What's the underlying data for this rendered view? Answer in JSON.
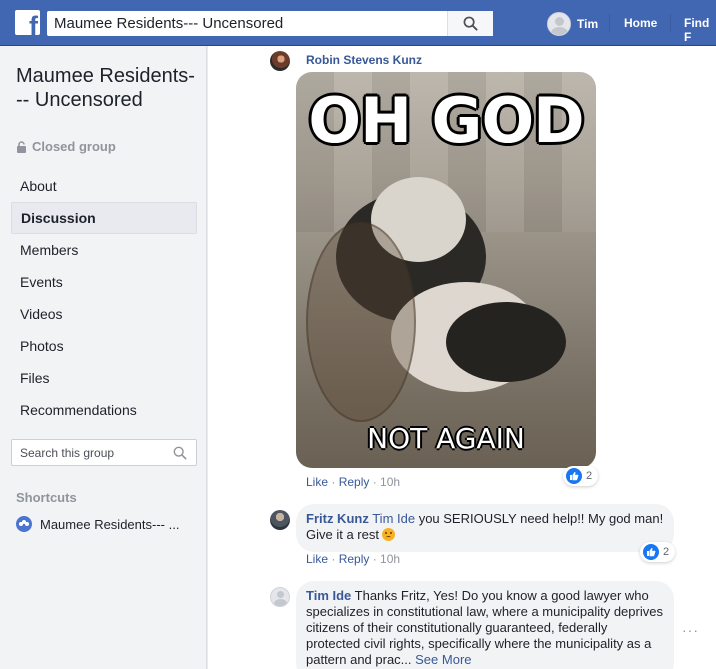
{
  "topbar": {
    "logo_letter": "f",
    "search_value": "Maumee Residents--- Uncensored",
    "user_name": "Tim",
    "nav_home": "Home",
    "nav_find": "Find F"
  },
  "group": {
    "title": "Maumee Residents--- Uncensored",
    "privacy": "Closed group"
  },
  "left_nav": {
    "items": [
      {
        "label": "About"
      },
      {
        "label": "Discussion"
      },
      {
        "label": "Members"
      },
      {
        "label": "Events"
      },
      {
        "label": "Videos"
      },
      {
        "label": "Photos"
      },
      {
        "label": "Files"
      },
      {
        "label": "Recommendations"
      }
    ],
    "active": "Discussion",
    "search_placeholder": "Search this group",
    "shortcuts_title": "Shortcuts",
    "shortcut_item": "Maumee Residents--- ..."
  },
  "comments": [
    {
      "author": "Robin Stevens Kunz",
      "gif_top_text": "OH GOD",
      "gif_bottom_text": "NOT AGAIN",
      "reaction_count": "2",
      "like": "Like",
      "reply": "Reply",
      "time": "10h"
    },
    {
      "author": "Fritz Kunz",
      "mention": "Tim Ide",
      "text": " you SERIOUSLY need help!! My god man! Give it a rest",
      "reaction_count": "2",
      "like": "Like",
      "reply": "Reply",
      "time": "10h"
    },
    {
      "author": "Tim Ide",
      "text": " Thanks Fritz, Yes! Do you know a good lawyer who specializes in constitutional law, where a municipality deprives citizens of their constitutionally guaranteed, federally protected civil rights, specifically where the municipality as a pattern and prac...",
      "see_more": "See More"
    }
  ],
  "colors": {
    "topbar": "#4267b2",
    "link": "#385898",
    "like_blue": "#1877f2",
    "sidebar_bg": "#f2f3f5"
  },
  "icons": {
    "logo": "facebook-logo-icon",
    "search": "search-icon",
    "lock": "lock-icon",
    "group": "group-icon",
    "like": "like-thumb-icon",
    "more": "more-dots-icon"
  }
}
